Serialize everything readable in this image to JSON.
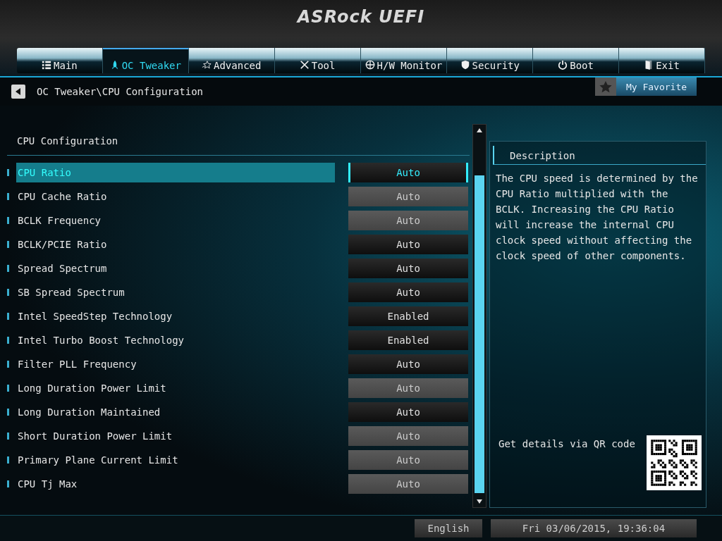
{
  "header": {
    "logo": "ASRock UEFI"
  },
  "tabs": [
    {
      "label": "Main",
      "selected": false
    },
    {
      "label": "OC Tweaker",
      "selected": true
    },
    {
      "label": "Advanced",
      "selected": false
    },
    {
      "label": "Tool",
      "selected": false
    },
    {
      "label": "H/W Monitor",
      "selected": false
    },
    {
      "label": "Security",
      "selected": false
    },
    {
      "label": "Boot",
      "selected": false
    },
    {
      "label": "Exit",
      "selected": false
    }
  ],
  "breadcrumb": "OC Tweaker\\CPU Configuration",
  "favorite": {
    "label": "My Favorite"
  },
  "section_title": "CPU Configuration",
  "settings": [
    {
      "name": "CPU Ratio",
      "value": "Auto",
      "selected": true,
      "disabled": false
    },
    {
      "name": "CPU Cache Ratio",
      "value": "Auto",
      "selected": false,
      "disabled": true
    },
    {
      "name": "BCLK Frequency",
      "value": "Auto",
      "selected": false,
      "disabled": true
    },
    {
      "name": "BCLK/PCIE Ratio",
      "value": "Auto",
      "selected": false,
      "disabled": false
    },
    {
      "name": "Spread Spectrum",
      "value": "Auto",
      "selected": false,
      "disabled": false
    },
    {
      "name": "SB Spread Spectrum",
      "value": "Auto",
      "selected": false,
      "disabled": false
    },
    {
      "name": "Intel SpeedStep Technology",
      "value": "Enabled",
      "selected": false,
      "disabled": false
    },
    {
      "name": "Intel Turbo Boost Technology",
      "value": "Enabled",
      "selected": false,
      "disabled": false
    },
    {
      "name": "Filter PLL Frequency",
      "value": "Auto",
      "selected": false,
      "disabled": false
    },
    {
      "name": "Long Duration Power Limit",
      "value": "Auto",
      "selected": false,
      "disabled": true
    },
    {
      "name": "Long Duration Maintained",
      "value": "Auto",
      "selected": false,
      "disabled": false
    },
    {
      "name": "Short Duration Power Limit",
      "value": "Auto",
      "selected": false,
      "disabled": true
    },
    {
      "name": "Primary Plane Current Limit",
      "value": "Auto",
      "selected": false,
      "disabled": true
    },
    {
      "name": "CPU Tj Max",
      "value": "Auto",
      "selected": false,
      "disabled": true
    }
  ],
  "description": {
    "title": "Description",
    "text": "The CPU speed is determined by the CPU Ratio multiplied with the BCLK. Increasing the CPU Ratio will increase the internal CPU clock speed without affecting the clock speed of other components.",
    "qr_label": "Get details via QR code"
  },
  "status_bar": {
    "language": "English",
    "datetime": "Fri 03/06/2015, 19:36:04"
  }
}
